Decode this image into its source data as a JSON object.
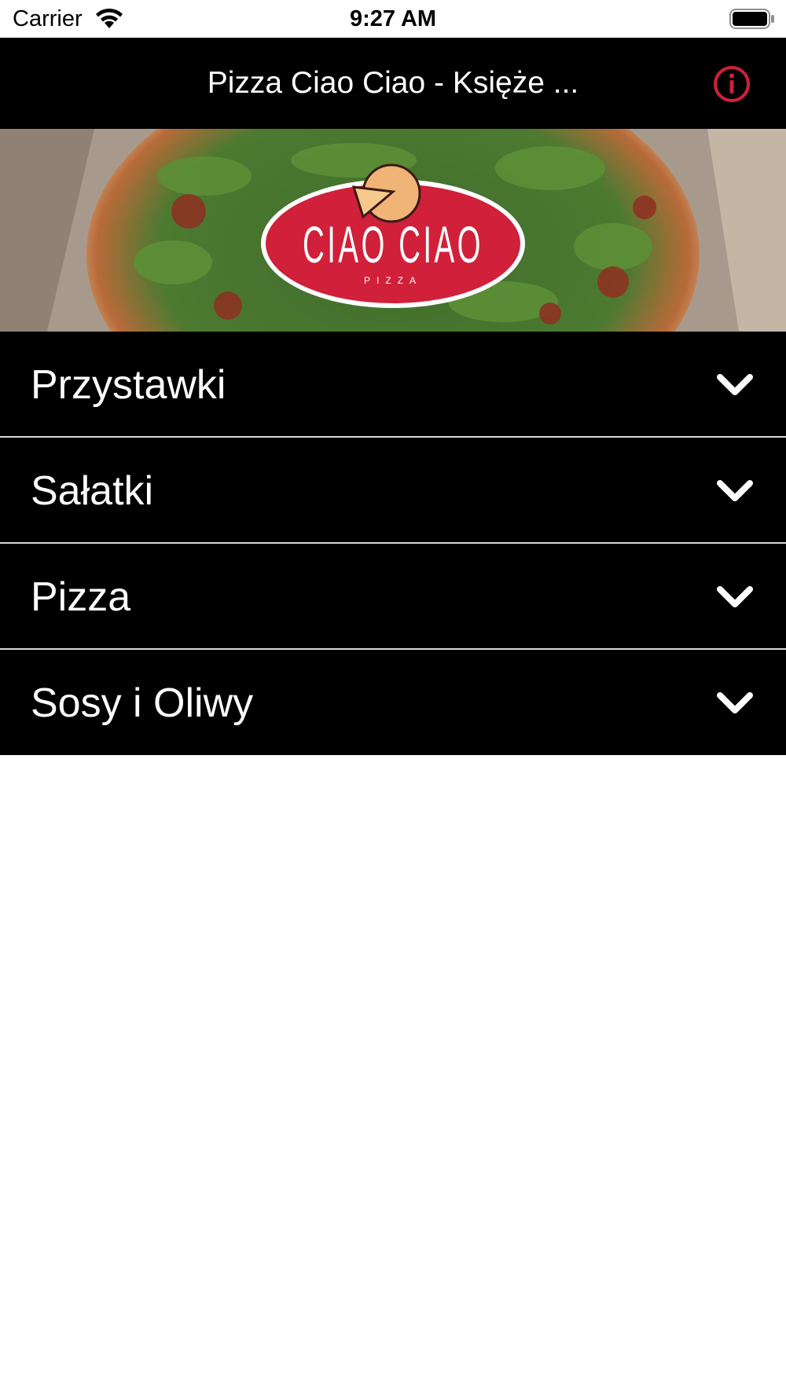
{
  "status_bar": {
    "carrier": "Carrier",
    "time": "9:27 AM",
    "icons": [
      "wifi-icon",
      "battery-icon"
    ]
  },
  "nav_bar": {
    "title": "Pizza Ciao Ciao - Księże ...",
    "info_icon": "info-circle-icon",
    "accent_color": "#d0203a"
  },
  "hero": {
    "logo_text": "CIAO CIAO",
    "logo_subtext": "PIZZA",
    "logo_color": "#d0203a"
  },
  "menu": {
    "items": [
      {
        "label": "Przystawki",
        "icon": "chevron-down-icon"
      },
      {
        "label": "Sałatki",
        "icon": "chevron-down-icon"
      },
      {
        "label": "Pizza",
        "icon": "chevron-down-icon"
      },
      {
        "label": "Sosy i Oliwy",
        "icon": "chevron-down-icon"
      }
    ]
  }
}
